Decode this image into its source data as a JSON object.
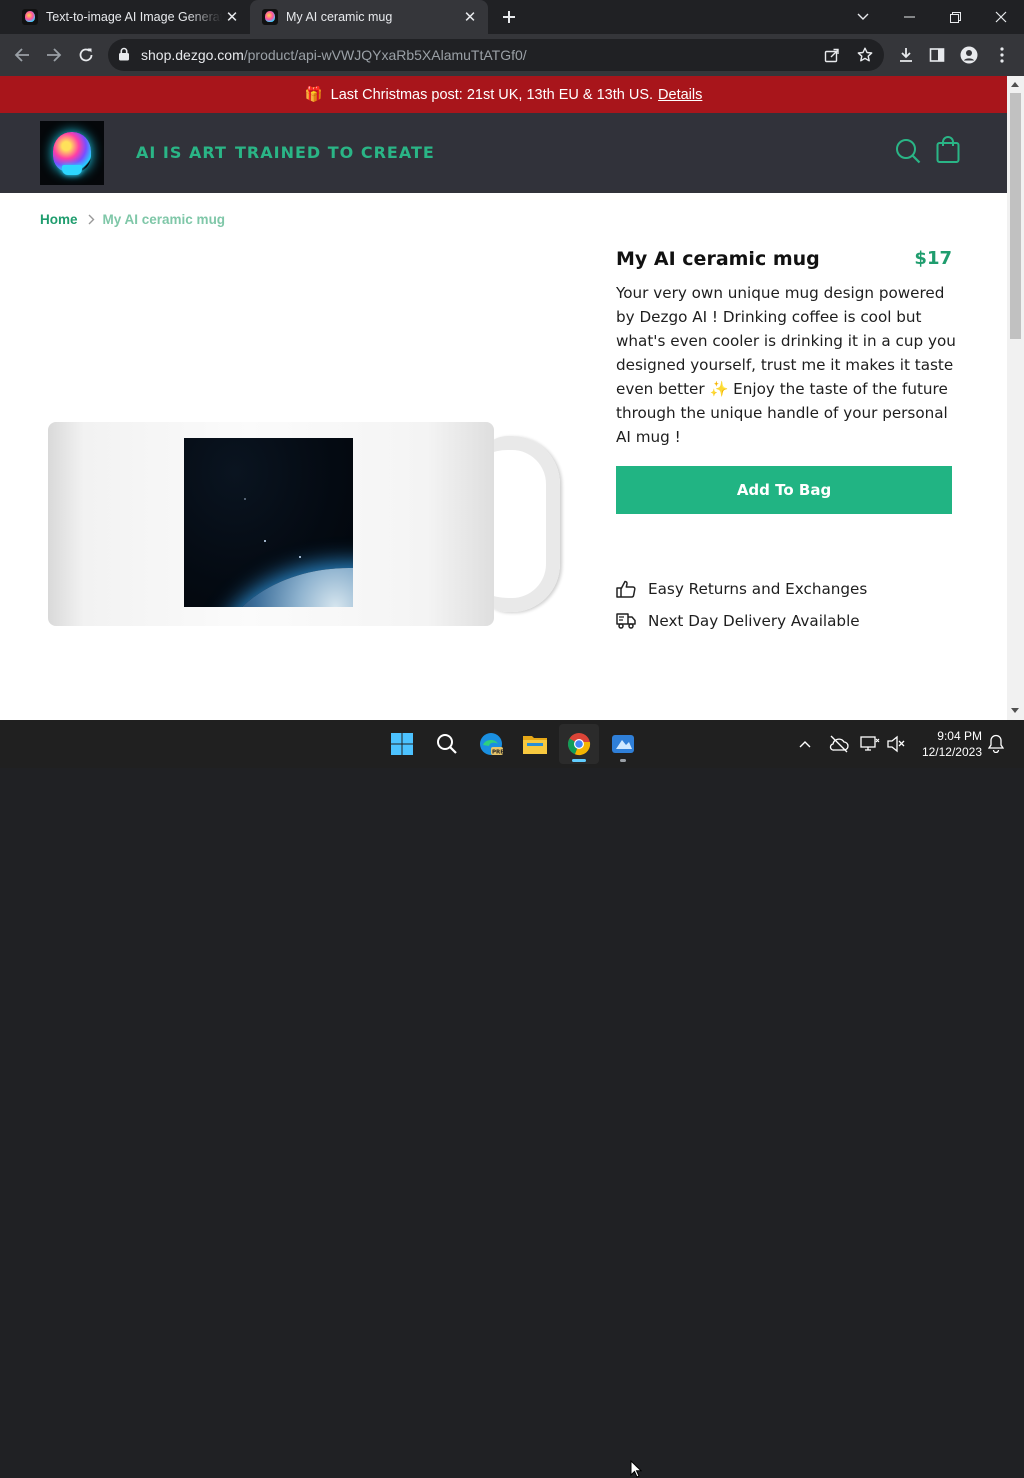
{
  "browser": {
    "tabs": [
      {
        "title": "Text-to-image AI Image Generator",
        "active": false
      },
      {
        "title": "My AI ceramic mug",
        "active": true
      }
    ],
    "url_host": "shop.dezgo.com",
    "url_path": "/product/api-wVWJQYxaRb5XAlamuTtATGf0/"
  },
  "banner": {
    "text": "Last Christmas post: 21st UK, 13th EU & 13th US.",
    "link": "Details"
  },
  "header": {
    "tagline_1": "AI IS ART",
    "tagline_2": "TRAINED TO CREATE"
  },
  "breadcrumb": {
    "home": "Home",
    "current": "My AI ceramic mug"
  },
  "product": {
    "title": "My AI ceramic mug",
    "price": "$17",
    "description": "Your very own unique mug design powered by Dezgo AI ! Drinking coffee is cool but what's even cooler is drinking it in a cup you designed yourself, trust me it makes it taste even better ✨ Enjoy the taste of the future through the unique handle of your personal AI mug !",
    "add_to_bag": "Add To Bag",
    "features": [
      "Easy Returns and Exchanges",
      "Next Day Delivery Available"
    ]
  },
  "taskbar": {
    "time": "9:04 PM",
    "date": "12/12/2023"
  },
  "colors": {
    "accent": "#21b483",
    "banner": "#a8151b",
    "header": "#31323a"
  }
}
